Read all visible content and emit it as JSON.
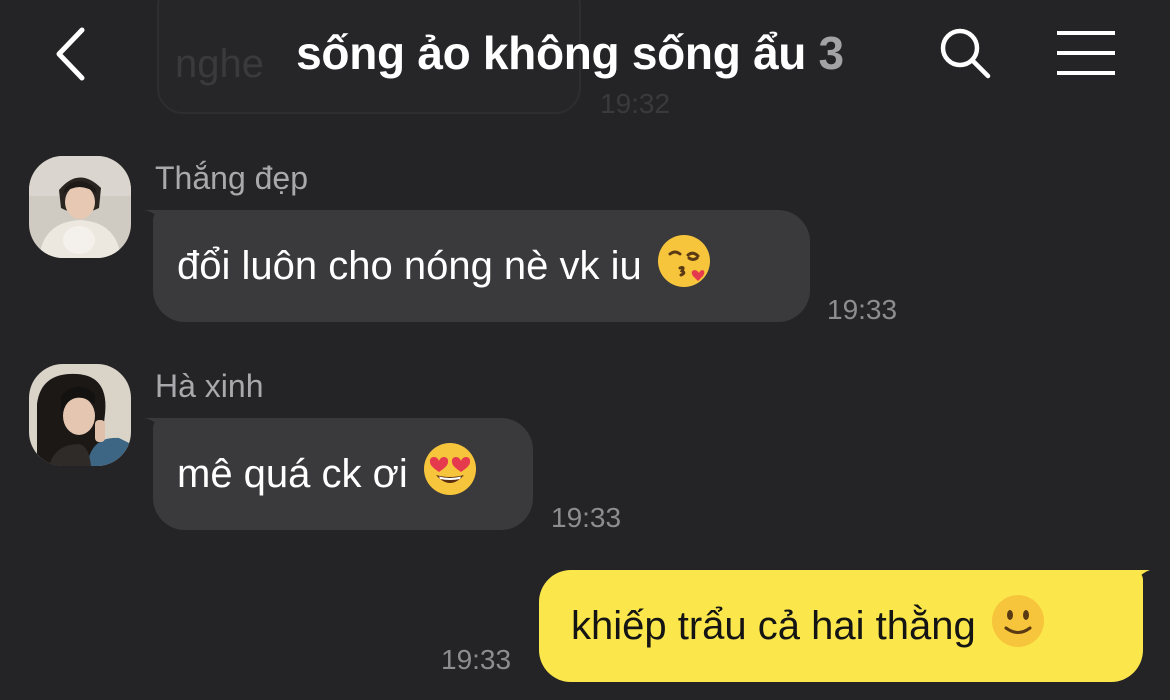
{
  "previous_message": {
    "text": "nghe",
    "time": "19:32"
  },
  "header": {
    "title": "sống ảo không sống ẩu",
    "member_count": "3",
    "back_icon": "chevron-left-icon",
    "search_icon": "search-icon",
    "menu_icon": "hamburger-menu-icon"
  },
  "messages": [
    {
      "sender": "Thắng đẹp",
      "text": "đổi luôn cho nóng nè vk iu",
      "emoji": "kissing-face-with-heart-emoji",
      "time": "19:33"
    },
    {
      "sender": "Hà xinh",
      "text": "mê quá ck ơi",
      "emoji": "heart-eyes-emoji",
      "time": "19:33"
    },
    {
      "sender": "",
      "text": "khiếp trẩu cả hai thằng",
      "emoji": "slightly-smiling-face-emoji",
      "time": "19:33",
      "mine": true
    }
  ],
  "colors": {
    "background": "#242426",
    "bubble_other": "#3a3a3c",
    "bubble_mine": "#fbe74b",
    "time": "#8d8d91",
    "sender": "#a9a9ad"
  }
}
